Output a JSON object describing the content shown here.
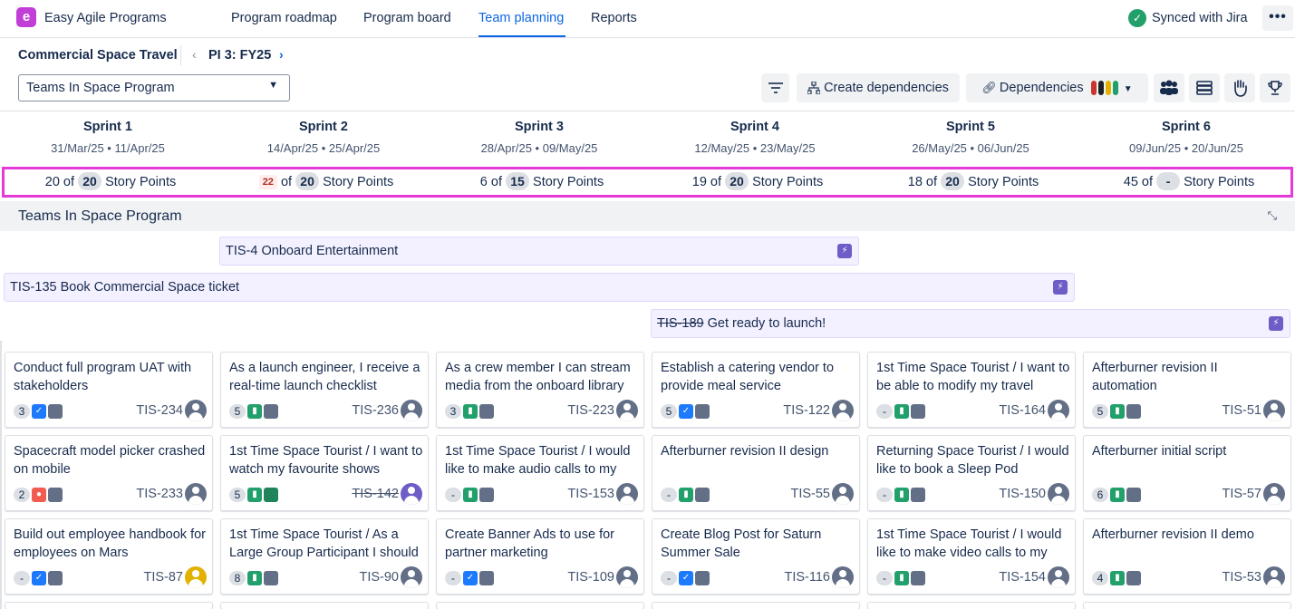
{
  "app": {
    "logo_letter": "e",
    "title": "Easy Agile Programs"
  },
  "nav": {
    "tabs": [
      "Program roadmap",
      "Program board",
      "Team planning",
      "Reports"
    ],
    "active_index": 2,
    "sync_status": "Synced with Jira",
    "more_label": "•••"
  },
  "breadcrumb": {
    "program": "Commercial Space Travel",
    "increment": "PI 3: FY25"
  },
  "toolbar": {
    "team_select_value": "Teams In Space Program",
    "create_dependencies_label": "Create dependencies",
    "dependencies_label": "Dependencies",
    "dependency_colors": [
      "#c9372c",
      "#1d2125",
      "#e2b203",
      "#22a06b"
    ]
  },
  "sprints": [
    {
      "name": "Sprint 1",
      "dates": "31/Mar/25 • 11/Apr/25",
      "used": "20",
      "capacity": "20",
      "over": false
    },
    {
      "name": "Sprint 2",
      "dates": "14/Apr/25 • 25/Apr/25",
      "used": "22",
      "capacity": "20",
      "over": true
    },
    {
      "name": "Sprint 3",
      "dates": "28/Apr/25 • 09/May/25",
      "used": "6",
      "capacity": "15",
      "over": false
    },
    {
      "name": "Sprint 4",
      "dates": "12/May/25 • 23/May/25",
      "used": "19",
      "capacity": "20",
      "over": false
    },
    {
      "name": "Sprint 5",
      "dates": "26/May/25 • 06/Jun/25",
      "used": "18",
      "capacity": "20",
      "over": false
    },
    {
      "name": "Sprint 6",
      "dates": "09/Jun/25 • 20/Jun/25",
      "used": "45",
      "capacity": "-",
      "over": false
    }
  ],
  "capacity_of": "of",
  "capacity_unit": "Story Points",
  "group": {
    "title": "Teams In Space Program"
  },
  "features": [
    {
      "key": "TIS-4",
      "title": "Onboard Entertainment",
      "done": false
    },
    {
      "key": "TIS-135",
      "title": "Book Commercial Space ticket",
      "done": false
    },
    {
      "key": "TIS-189",
      "title": "Get ready to launch!",
      "done": true
    }
  ],
  "cards": [
    {
      "summary": "Conduct full program UAT with stakeholders",
      "points": "3",
      "type": "task",
      "key": "TIS-234",
      "done": false,
      "avatar": "default"
    },
    {
      "summary": "As a launch engineer, I receive a real-time launch checklist",
      "points": "5",
      "type": "story",
      "key": "TIS-236",
      "done": false,
      "avatar": "default"
    },
    {
      "summary": "As a crew member I can stream media from the onboard library",
      "points": "3",
      "type": "story",
      "key": "TIS-223",
      "done": false,
      "avatar": "default"
    },
    {
      "summary": "Establish a catering vendor to provide meal service",
      "points": "5",
      "type": "task",
      "key": "TIS-122",
      "done": false,
      "avatar": "default"
    },
    {
      "summary": "1st Time Space Tourist / I want to be able to modify my travel",
      "points": "-",
      "type": "story",
      "key": "TIS-164",
      "done": false,
      "avatar": "default"
    },
    {
      "summary": "Afterburner revision II automation",
      "points": "5",
      "type": "story",
      "key": "TIS-51",
      "done": false,
      "avatar": "default"
    },
    {
      "summary": "Spacecraft model picker crashed on mobile",
      "points": "2",
      "type": "bug",
      "key": "TIS-233",
      "done": false,
      "avatar": "default"
    },
    {
      "summary": "1st Time Space Tourist / I want to watch my favourite shows",
      "points": "5",
      "type": "story",
      "key": "TIS-142",
      "done": true,
      "avatar": "person-a"
    },
    {
      "summary": "1st Time Space Tourist / I would like to make audio calls to my",
      "points": "-",
      "type": "story",
      "key": "TIS-153",
      "done": false,
      "avatar": "default"
    },
    {
      "summary": "Afterburner revision II design",
      "points": "-",
      "type": "story",
      "key": "TIS-55",
      "done": false,
      "avatar": "default"
    },
    {
      "summary": "Returning Space Tourist / I would like to book a Sleep Pod",
      "points": "-",
      "type": "story",
      "key": "TIS-150",
      "done": false,
      "avatar": "default"
    },
    {
      "summary": "Afterburner initial script",
      "points": "6",
      "type": "story",
      "key": "TIS-57",
      "done": false,
      "avatar": "default"
    },
    {
      "summary": "Build out employee handbook for employees on Mars",
      "points": "-",
      "type": "task",
      "key": "TIS-87",
      "done": false,
      "avatar": "person-b"
    },
    {
      "summary": "1st Time Space Tourist / As a Large Group Participant I should",
      "points": "8",
      "type": "story",
      "key": "TIS-90",
      "done": false,
      "avatar": "default"
    },
    {
      "summary": "Create Banner Ads to use for partner marketing",
      "points": "-",
      "type": "task",
      "key": "TIS-109",
      "done": false,
      "avatar": "default"
    },
    {
      "summary": "Create Blog Post for Saturn Summer Sale",
      "points": "-",
      "type": "task",
      "key": "TIS-116",
      "done": false,
      "avatar": "default"
    },
    {
      "summary": "1st Time Space Tourist / I would like to make video calls to my",
      "points": "-",
      "type": "story",
      "key": "TIS-154",
      "done": false,
      "avatar": "default"
    },
    {
      "summary": "Afterburner revision II demo",
      "points": "4",
      "type": "story",
      "key": "TIS-53",
      "done": false,
      "avatar": "default"
    }
  ]
}
